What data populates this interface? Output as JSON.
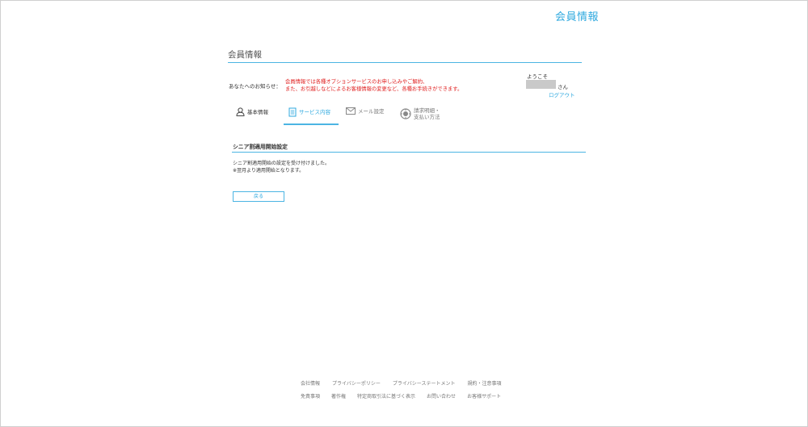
{
  "header": {
    "title": "会員情報"
  },
  "page": {
    "title": "会員情報"
  },
  "notice": {
    "label": "あなたへのお知らせ：",
    "line1": "会員情報では各種オプションサービスのお申し込みやご解約、",
    "line2": "また、お引越しなどによるお客様情報の変更など、各種お手続きができます。"
  },
  "user": {
    "welcome": "ようこそ",
    "suffix": "さん",
    "logout": "ログアウト"
  },
  "tabs": [
    {
      "label": "基本情報",
      "icon": "person-icon"
    },
    {
      "label": "サービス内容",
      "icon": "document-icon"
    },
    {
      "label": "メール設定",
      "icon": "envelope-icon"
    },
    {
      "label_line1": "請求明細・",
      "label_line2": "支払い方法",
      "icon": "billing-icon"
    }
  ],
  "section": {
    "title": "シニア割適用開始設定",
    "message_line1": "シニア割適用開始の設定を受け付けました。",
    "message_line2": "※翌月より適用開始となります。"
  },
  "back_button": "戻る",
  "footer": {
    "row1": [
      "会社情報",
      "プライバシーポリシー",
      "プライバシーステートメント",
      "規約・注意事項"
    ],
    "row2": [
      "免責事項",
      "著作権",
      "特定商取引法に基づく表示",
      "お問い合わせ",
      "お客様サポート"
    ]
  },
  "colors": {
    "accent": "#2fa9df",
    "notice": "#e02020",
    "rule": "#4cb5e3"
  }
}
